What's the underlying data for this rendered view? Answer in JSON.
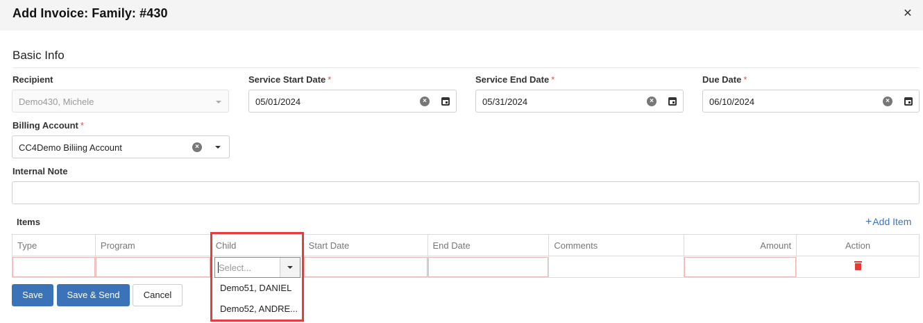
{
  "dialog": {
    "title": "Add Invoice: Family: #430",
    "close_icon": "close-icon"
  },
  "basic_info": {
    "section_title": "Basic Info",
    "recipient": {
      "label": "Recipient",
      "value": "Demo430, Michele"
    },
    "service_start": {
      "label": "Service Start Date",
      "required_mark": "*",
      "value": "05/01/2024"
    },
    "service_end": {
      "label": "Service End Date",
      "required_mark": "*",
      "value": "05/31/2024"
    },
    "due_date": {
      "label": "Due Date",
      "required_mark": "*",
      "value": "06/10/2024"
    },
    "billing_account": {
      "label": "Billing Account",
      "required_mark": "*",
      "value": "CC4Demo Biliing Account"
    },
    "internal_note": {
      "label": "Internal Note",
      "value": ""
    }
  },
  "items": {
    "label": "Items",
    "add_item_label": "Add Item",
    "add_item_prefix": "+",
    "columns": [
      "Type",
      "Program",
      "Child",
      "Start Date",
      "End Date",
      "Comments",
      "Amount",
      "Action"
    ],
    "child_select": {
      "placeholder": "Select...",
      "options": [
        "Demo51, DANIEL",
        "Demo52, ANDRE..."
      ]
    }
  },
  "actions": {
    "save": "Save",
    "save_send": "Save & Send",
    "cancel": "Cancel"
  },
  "colors": {
    "primary": "#3a73b8",
    "required": "#d9534f",
    "highlight": "#e53d3d",
    "delete": "#e53935"
  }
}
